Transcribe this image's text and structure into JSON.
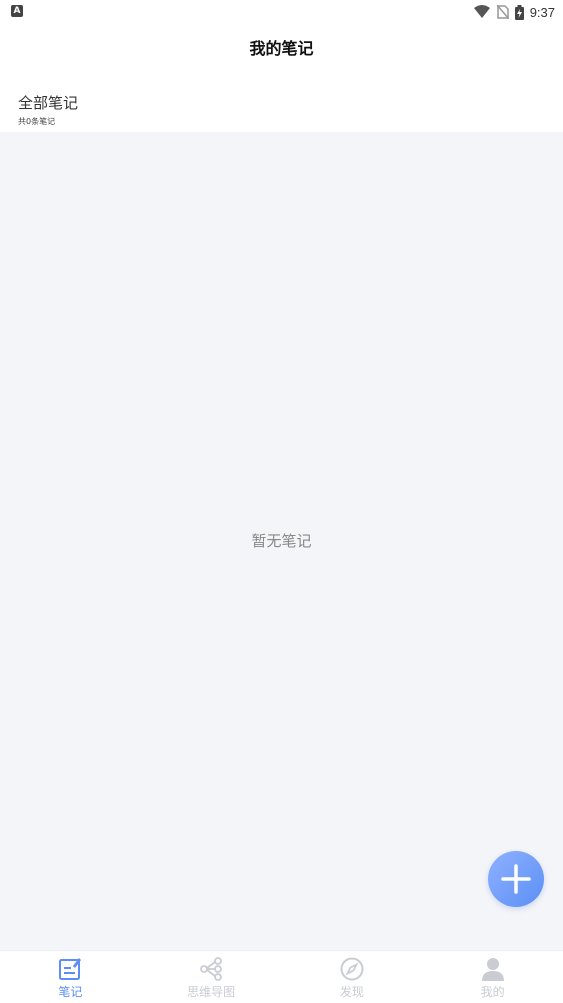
{
  "status_bar": {
    "left_icon": "A",
    "time": "9:37",
    "icons": [
      "wifi-icon",
      "no-sim-icon",
      "battery-charging-icon"
    ]
  },
  "header": {
    "title": "我的笔记"
  },
  "notes_section": {
    "title": "全部笔记",
    "count_label": "共0条笔记"
  },
  "empty_state": {
    "message": "暂无笔记"
  },
  "fab": {
    "icon": "plus-icon"
  },
  "bottom_nav": {
    "items": [
      {
        "label": "笔记",
        "icon": "note-edit-icon",
        "active": true
      },
      {
        "label": "思维导图",
        "icon": "mind-map-icon",
        "active": false
      },
      {
        "label": "发现",
        "icon": "compass-icon",
        "active": false
      },
      {
        "label": "我的",
        "icon": "user-icon",
        "active": false
      }
    ]
  },
  "colors": {
    "accent": "#5b8ff5",
    "inactive": "#c9ccd3",
    "background": "#f4f5f8"
  }
}
